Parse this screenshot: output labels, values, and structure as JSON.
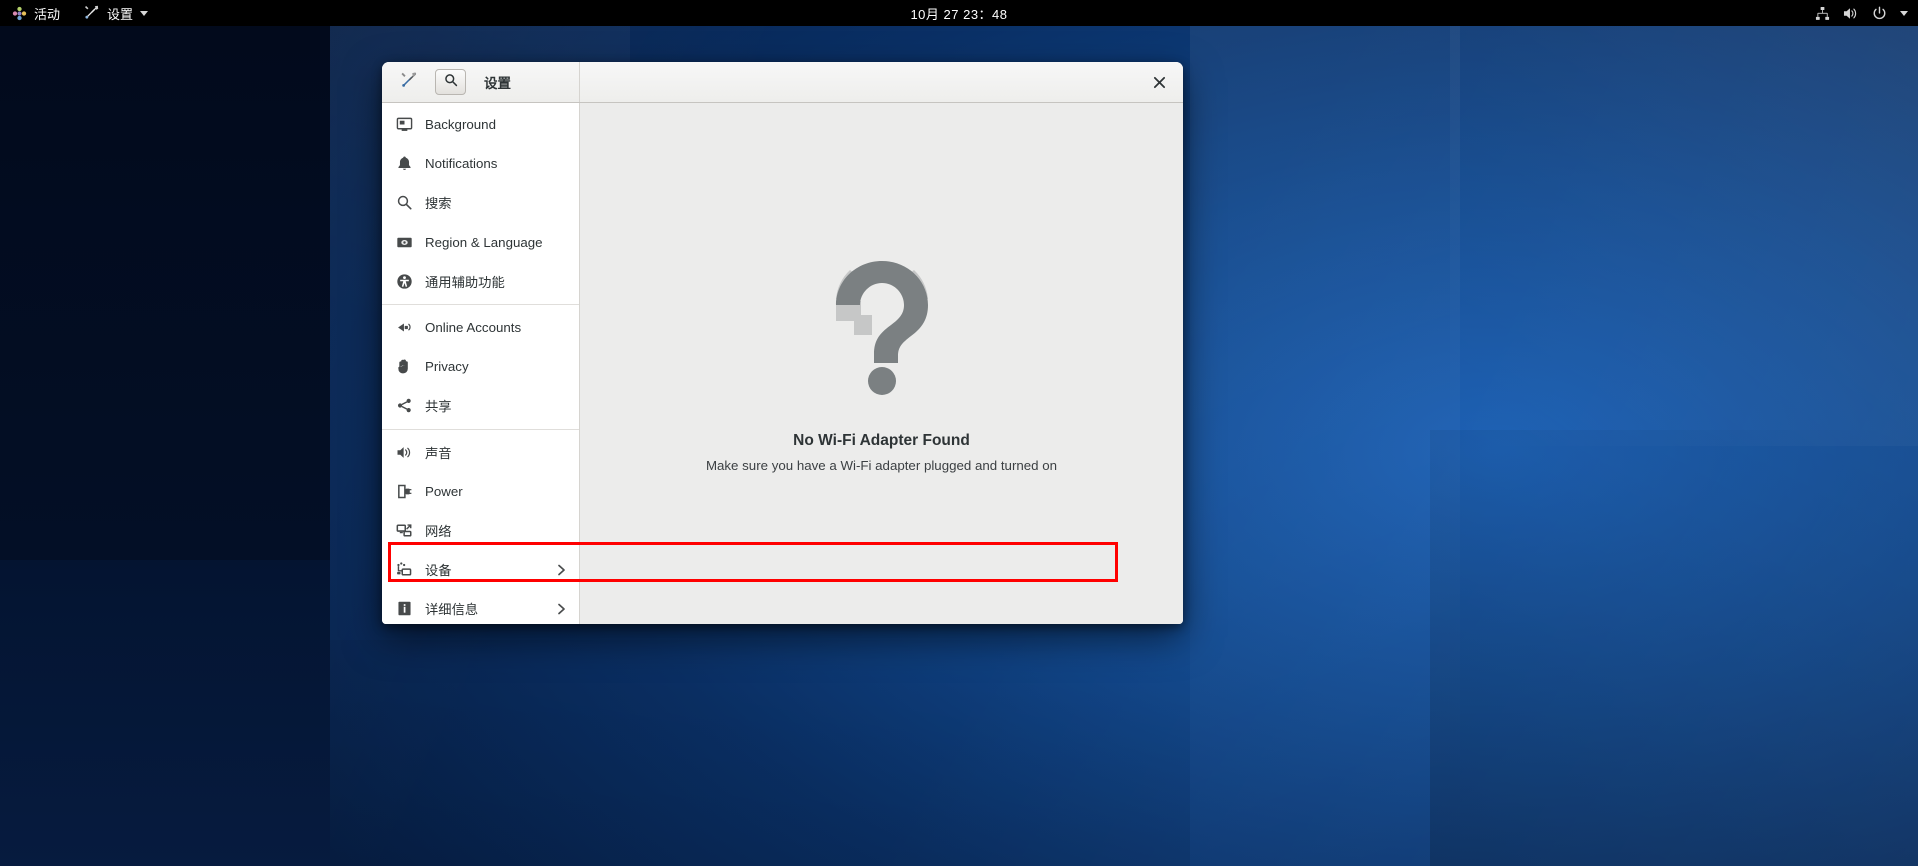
{
  "topbar": {
    "activities_label": "活动",
    "app_menu_label": "设置",
    "app_menu_icon": "tools-icon",
    "clock": "10月 27  23：48",
    "status_icons": [
      "network-wired-icon",
      "volume-icon",
      "power-icon",
      "chevron-down-icon"
    ]
  },
  "window": {
    "title": "设置",
    "header_tools_icon": "tools-icon",
    "header_search_icon": "search-icon",
    "close_label": "×"
  },
  "sidebar": {
    "items": [
      {
        "label": "Background",
        "icon": "background-icon",
        "chevron": "",
        "separator_after": false,
        "selected": false
      },
      {
        "label": "Notifications",
        "icon": "bell-icon",
        "chevron": "",
        "separator_after": false,
        "selected": false
      },
      {
        "label": "搜索",
        "icon": "search-icon",
        "chevron": "",
        "separator_after": false,
        "selected": false
      },
      {
        "label": "Region & Language",
        "icon": "flag-icon",
        "chevron": "",
        "separator_after": false,
        "selected": false
      },
      {
        "label": "通用辅助功能",
        "icon": "accessibility-icon",
        "chevron": "",
        "separator_after": true,
        "selected": false
      },
      {
        "label": "Online Accounts",
        "icon": "plug-icon",
        "chevron": "",
        "separator_after": false,
        "selected": false
      },
      {
        "label": "Privacy",
        "icon": "hand-icon",
        "chevron": "",
        "separator_after": false,
        "selected": false
      },
      {
        "label": "共享",
        "icon": "share-icon",
        "chevron": "",
        "separator_after": true,
        "selected": false
      },
      {
        "label": "声音",
        "icon": "speaker-icon",
        "chevron": "",
        "separator_after": false,
        "selected": false
      },
      {
        "label": "Power",
        "icon": "battery-plug-icon",
        "chevron": "",
        "separator_after": false,
        "selected": false
      },
      {
        "label": "网络",
        "icon": "network-icon",
        "chevron": "",
        "separator_after": false,
        "selected": false
      },
      {
        "label": "设备",
        "icon": "devices-icon",
        "chevron": "›",
        "separator_after": false,
        "selected": true
      },
      {
        "label": "详细信息",
        "icon": "info-icon",
        "chevron": "›",
        "separator_after": false,
        "selected": false
      }
    ]
  },
  "content": {
    "placeholder_icon": "question-mark-icon",
    "title": "No Wi-Fi Adapter Found",
    "subtitle": "Make sure you have a Wi-Fi adapter plugged and turned on"
  },
  "annotation": {
    "highlight_color": "#ff0000",
    "target": "设备"
  }
}
